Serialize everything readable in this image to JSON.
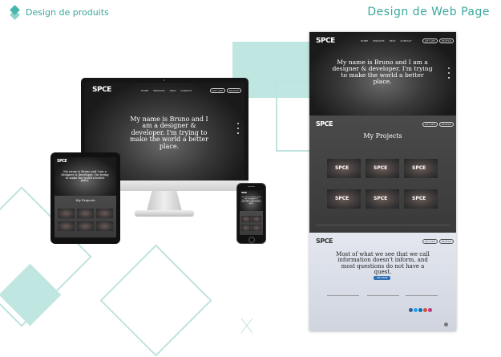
{
  "header": {
    "left_title": "Design de produits",
    "right_title": "Design de Web Page"
  },
  "brand": {
    "logo_text": "SPCE"
  },
  "nav": {
    "items": [
      "HOME",
      "SERVICES",
      "HELP",
      "CONTACT"
    ],
    "pill_one": "GET APP",
    "pill_two": "PROFILE"
  },
  "hero": {
    "headline": "My name is Bruno and I am a designer & developer. I'm trying to make the world a better place."
  },
  "projects": {
    "title": "My Projects",
    "thumb_label": "SPCE"
  },
  "quote": {
    "text": "Most of what we see that we call information doesn't inform, and most questions do not have a quest.",
    "button": "SEE MORE"
  },
  "colors": {
    "accent": "#3aa79d",
    "deco": "#bfe3df"
  }
}
